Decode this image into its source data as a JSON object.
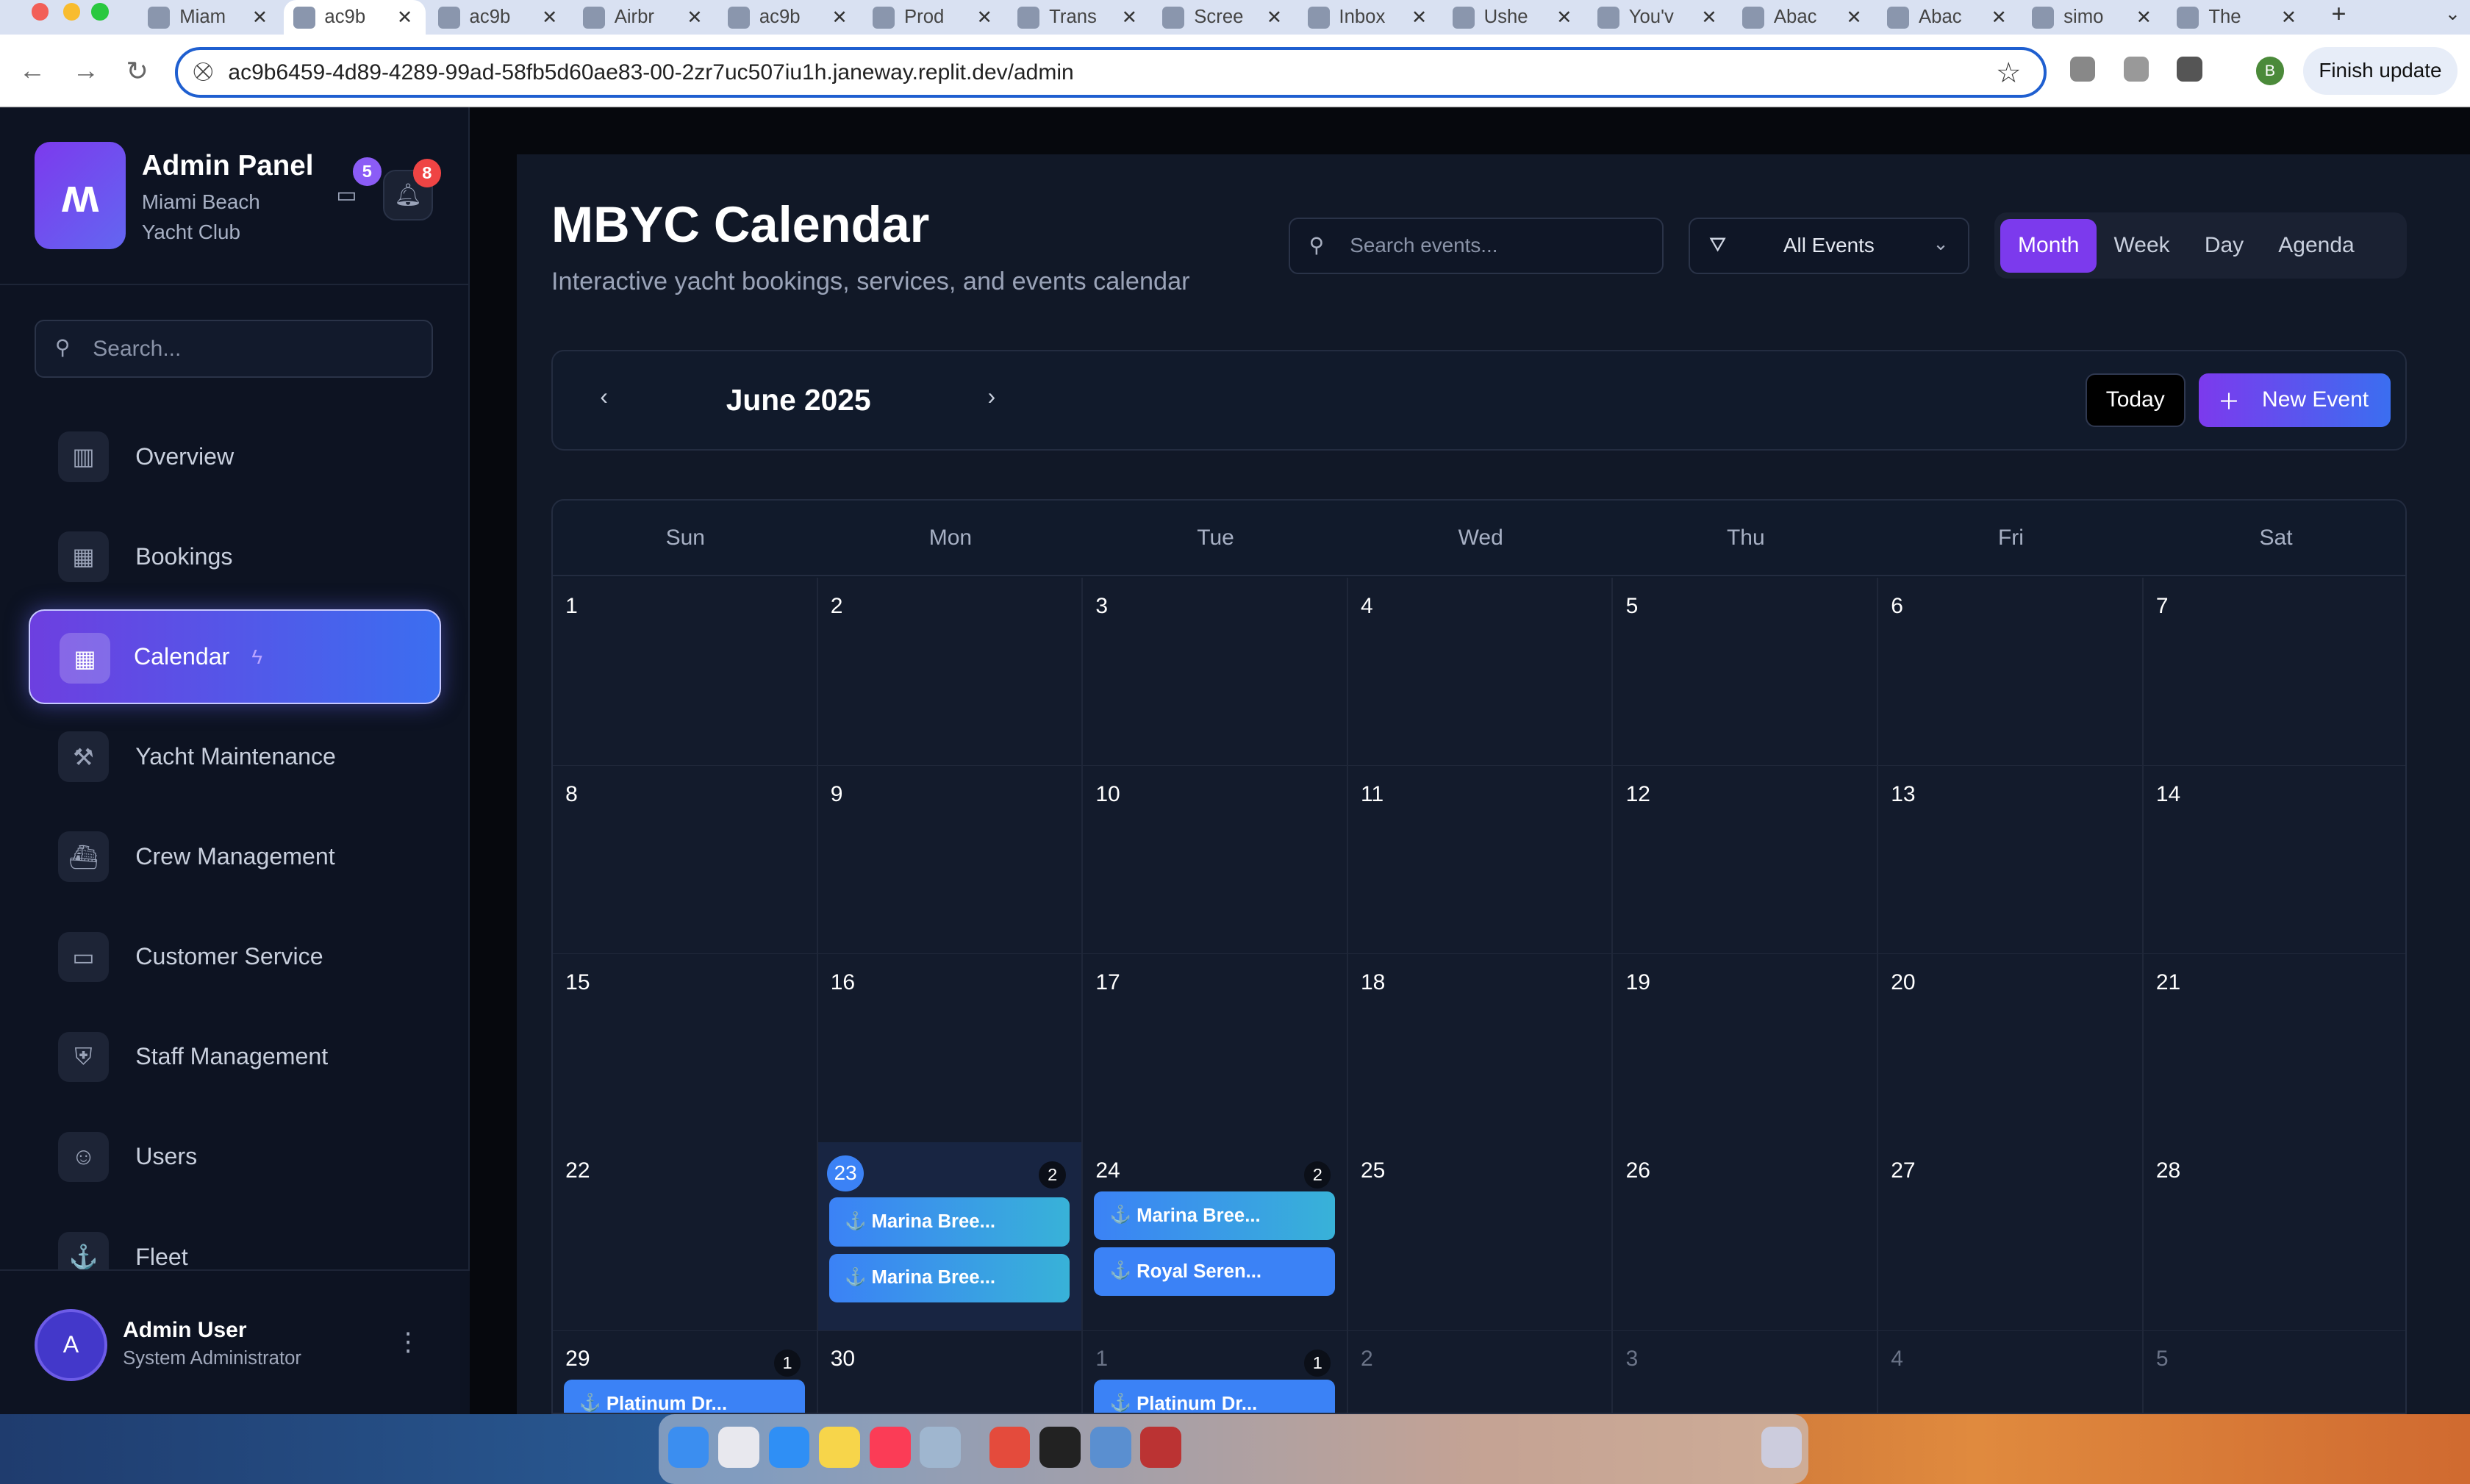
{
  "browser": {
    "tabs": [
      {
        "label": "Miam",
        "active": false
      },
      {
        "label": "ac9b",
        "active": true
      },
      {
        "label": "ac9b",
        "active": false
      },
      {
        "label": "Airbr",
        "active": false
      },
      {
        "label": "ac9b",
        "active": false
      },
      {
        "label": "Prod",
        "active": false
      },
      {
        "label": "Trans",
        "active": false
      },
      {
        "label": "Scree",
        "active": false
      },
      {
        "label": "Inbox",
        "active": false
      },
      {
        "label": "Ushe",
        "active": false
      },
      {
        "label": "You'v",
        "active": false
      },
      {
        "label": "Abac",
        "active": false
      },
      {
        "label": "Abac",
        "active": false
      },
      {
        "label": "simo",
        "active": false
      },
      {
        "label": "The",
        "active": false
      }
    ],
    "url": "ac9b6459-4d89-4289-99ad-58fb5d60ae83-00-2zr7uc507iu1h.janeway.replit.dev/admin",
    "profile_initial": "B",
    "finish_update_label": "Finish update"
  },
  "sidebar": {
    "title": "Admin Panel",
    "subtitle": "Miami Beach Yacht Club",
    "messages_badge": "5",
    "notifications_badge": "8",
    "search_placeholder": "Search...",
    "items": [
      {
        "label": "Overview",
        "icon": "bar-chart-icon",
        "active": false
      },
      {
        "label": "Bookings",
        "icon": "calendar-icon",
        "active": false
      },
      {
        "label": "Calendar",
        "icon": "calendar-grid-icon",
        "active": true
      },
      {
        "label": "Yacht Maintenance",
        "icon": "wrench-icon",
        "active": false
      },
      {
        "label": "Crew Management",
        "icon": "ship-icon",
        "active": false
      },
      {
        "label": "Customer Service",
        "icon": "message-icon",
        "active": false
      },
      {
        "label": "Staff Management",
        "icon": "shield-icon",
        "active": false
      },
      {
        "label": "Users",
        "icon": "users-icon",
        "active": false
      },
      {
        "label": "Fleet",
        "icon": "anchor-icon",
        "active": false
      }
    ],
    "user": {
      "initial": "A",
      "name": "Admin User",
      "role": "System Administrator"
    }
  },
  "main": {
    "title": "MBYC Calendar",
    "subtitle": "Interactive yacht bookings, services, and events calendar",
    "search_placeholder": "Search events...",
    "filter_value": "All Events",
    "views": [
      "Month",
      "Week",
      "Day",
      "Agenda"
    ],
    "active_view": "Month",
    "month_label": "June 2025",
    "today_label": "Today",
    "new_event_label": "New Event",
    "weekdays": [
      "Sun",
      "Mon",
      "Tue",
      "Wed",
      "Thu",
      "Fri",
      "Sat"
    ],
    "weeks": [
      [
        {
          "day": "1"
        },
        {
          "day": "2"
        },
        {
          "day": "3"
        },
        {
          "day": "4"
        },
        {
          "day": "5"
        },
        {
          "day": "6"
        },
        {
          "day": "7"
        }
      ],
      [
        {
          "day": "8"
        },
        {
          "day": "9"
        },
        {
          "day": "10"
        },
        {
          "day": "11"
        },
        {
          "day": "12"
        },
        {
          "day": "13"
        },
        {
          "day": "14"
        }
      ],
      [
        {
          "day": "15"
        },
        {
          "day": "16"
        },
        {
          "day": "17"
        },
        {
          "day": "18"
        },
        {
          "day": "19"
        },
        {
          "day": "20"
        },
        {
          "day": "21"
        }
      ],
      [
        {
          "day": "22"
        },
        {
          "day": "23",
          "today": true,
          "count": "2",
          "events": [
            {
              "label": "Marina Bree...",
              "style": "teal"
            },
            {
              "label": "Marina Bree...",
              "style": "teal"
            }
          ]
        },
        {
          "day": "24",
          "count": "2",
          "events": [
            {
              "label": "Marina Bree...",
              "style": "teal"
            },
            {
              "label": "Royal Seren...",
              "style": "blue"
            }
          ]
        },
        {
          "day": "25"
        },
        {
          "day": "26"
        },
        {
          "day": "27"
        },
        {
          "day": "28"
        }
      ],
      [
        {
          "day": "29",
          "count": "1",
          "events": [
            {
              "label": "Platinum Dr...",
              "style": "blue"
            }
          ]
        },
        {
          "day": "30"
        },
        {
          "day": "1",
          "other": true,
          "count": "1",
          "events": [
            {
              "label": "Platinum Dr...",
              "style": "blue"
            }
          ]
        },
        {
          "day": "2",
          "other": true
        },
        {
          "day": "3",
          "other": true
        },
        {
          "day": "4",
          "other": true
        },
        {
          "day": "5",
          "other": true
        }
      ]
    ]
  }
}
